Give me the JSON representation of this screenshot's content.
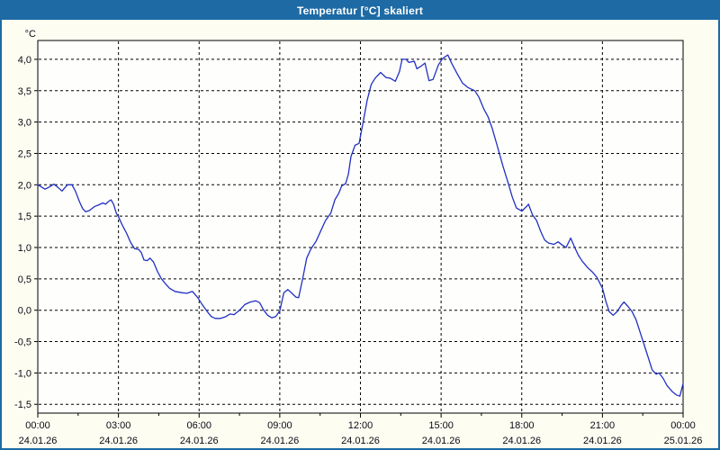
{
  "window": {
    "title": "Temperatur [°C] skaliert"
  },
  "colors": {
    "titlebar_bg": "#1d6aa5",
    "title_text": "#ffffff",
    "window_bg": "#fdfdf2",
    "plot_bg": "#fefefc",
    "grid": "#000000",
    "axis": "#000000",
    "tick_label": "#0a0a14",
    "series_line": "#2130c4"
  },
  "chart_data": {
    "type": "line",
    "title": "Temperatur [°C] skaliert",
    "unit_label": "°C",
    "xlabel": "",
    "ylabel": "°C",
    "xlim": [
      0,
      24
    ],
    "ylim": [
      -1.64,
      4.3
    ],
    "grid": true,
    "legend": "none",
    "yticks": [
      {
        "v": 4.0,
        "label": "4,0"
      },
      {
        "v": 3.5,
        "label": "3,5"
      },
      {
        "v": 3.0,
        "label": "3,0"
      },
      {
        "v": 2.5,
        "label": "2,5"
      },
      {
        "v": 2.0,
        "label": "2,0"
      },
      {
        "v": 1.5,
        "label": "1,5"
      },
      {
        "v": 1.0,
        "label": "1,0"
      },
      {
        "v": 0.5,
        "label": "0,5"
      },
      {
        "v": 0.0,
        "label": "0,0"
      },
      {
        "v": -0.5,
        "label": "-0,5"
      },
      {
        "v": -1.0,
        "label": "-1,0"
      },
      {
        "v": -1.5,
        "label": "-1,5"
      }
    ],
    "xticks": [
      {
        "h": 0,
        "time": "00:00",
        "date": "24.01.26"
      },
      {
        "h": 3,
        "time": "03:00",
        "date": "24.01.26"
      },
      {
        "h": 6,
        "time": "06:00",
        "date": "24.01.26"
      },
      {
        "h": 9,
        "time": "09:00",
        "date": "24.01.26"
      },
      {
        "h": 12,
        "time": "12:00",
        "date": "24.01.26"
      },
      {
        "h": 15,
        "time": "15:00",
        "date": "24.01.26"
      },
      {
        "h": 18,
        "time": "18:00",
        "date": "24.01.26"
      },
      {
        "h": 21,
        "time": "21:00",
        "date": "24.01.26"
      },
      {
        "h": 24,
        "time": "00:00",
        "date": "25.01.26"
      }
    ],
    "minor_xticks": [
      1.5,
      4.5,
      7.5,
      10.5,
      13.5,
      16.5,
      19.5,
      22.5
    ],
    "vertical_gridlines_at": [
      3,
      6,
      9,
      12,
      15,
      18,
      21
    ],
    "series": [
      {
        "name": "Temperatur",
        "color": "#2130c4",
        "points": [
          [
            0.0,
            2.0
          ],
          [
            0.27,
            1.93
          ],
          [
            0.45,
            1.97
          ],
          [
            0.6,
            2.01
          ],
          [
            0.77,
            1.95
          ],
          [
            0.9,
            1.9
          ],
          [
            1.0,
            1.95
          ],
          [
            1.1,
            2.0
          ],
          [
            1.27,
            2.0
          ],
          [
            1.4,
            1.9
          ],
          [
            1.55,
            1.73
          ],
          [
            1.67,
            1.62
          ],
          [
            1.78,
            1.57
          ],
          [
            1.92,
            1.59
          ],
          [
            2.1,
            1.65
          ],
          [
            2.27,
            1.68
          ],
          [
            2.42,
            1.71
          ],
          [
            2.52,
            1.69
          ],
          [
            2.62,
            1.73
          ],
          [
            2.72,
            1.76
          ],
          [
            2.82,
            1.69
          ],
          [
            2.92,
            1.55
          ],
          [
            3.0,
            1.49
          ],
          [
            3.15,
            1.35
          ],
          [
            3.3,
            1.23
          ],
          [
            3.45,
            1.08
          ],
          [
            3.6,
            0.98
          ],
          [
            3.75,
            0.97
          ],
          [
            3.85,
            0.92
          ],
          [
            3.95,
            0.8
          ],
          [
            4.07,
            0.79
          ],
          [
            4.17,
            0.83
          ],
          [
            4.3,
            0.77
          ],
          [
            4.45,
            0.62
          ],
          [
            4.6,
            0.5
          ],
          [
            4.75,
            0.42
          ],
          [
            4.9,
            0.35
          ],
          [
            5.1,
            0.3
          ],
          [
            5.35,
            0.28
          ],
          [
            5.55,
            0.27
          ],
          [
            5.75,
            0.3
          ],
          [
            5.95,
            0.2
          ],
          [
            6.1,
            0.1
          ],
          [
            6.3,
            -0.02
          ],
          [
            6.45,
            -0.1
          ],
          [
            6.6,
            -0.13
          ],
          [
            6.8,
            -0.13
          ],
          [
            7.0,
            -0.1
          ],
          [
            7.15,
            -0.06
          ],
          [
            7.3,
            -0.07
          ],
          [
            7.5,
            0.0
          ],
          [
            7.7,
            0.09
          ],
          [
            7.9,
            0.13
          ],
          [
            8.1,
            0.15
          ],
          [
            8.25,
            0.12
          ],
          [
            8.4,
            0.0
          ],
          [
            8.55,
            -0.08
          ],
          [
            8.7,
            -0.12
          ],
          [
            8.85,
            -0.1
          ],
          [
            9.0,
            -0.01
          ],
          [
            9.15,
            0.28
          ],
          [
            9.3,
            0.33
          ],
          [
            9.45,
            0.27
          ],
          [
            9.6,
            0.21
          ],
          [
            9.7,
            0.2
          ],
          [
            9.85,
            0.5
          ],
          [
            10.0,
            0.83
          ],
          [
            10.15,
            0.97
          ],
          [
            10.35,
            1.1
          ],
          [
            10.55,
            1.29
          ],
          [
            10.7,
            1.43
          ],
          [
            10.9,
            1.55
          ],
          [
            11.05,
            1.76
          ],
          [
            11.2,
            1.87
          ],
          [
            11.3,
            1.98
          ],
          [
            11.45,
            2.02
          ],
          [
            11.55,
            2.17
          ],
          [
            11.65,
            2.45
          ],
          [
            11.8,
            2.63
          ],
          [
            11.95,
            2.66
          ],
          [
            12.1,
            3.0
          ],
          [
            12.25,
            3.35
          ],
          [
            12.4,
            3.6
          ],
          [
            12.55,
            3.7
          ],
          [
            12.75,
            3.79
          ],
          [
            12.95,
            3.71
          ],
          [
            13.1,
            3.7
          ],
          [
            13.3,
            3.65
          ],
          [
            13.45,
            3.8
          ],
          [
            13.55,
            4.0
          ],
          [
            13.7,
            4.0
          ],
          [
            13.8,
            3.95
          ],
          [
            14.0,
            3.97
          ],
          [
            14.1,
            3.85
          ],
          [
            14.25,
            3.89
          ],
          [
            14.4,
            3.94
          ],
          [
            14.55,
            3.66
          ],
          [
            14.7,
            3.68
          ],
          [
            14.9,
            3.91
          ],
          [
            15.05,
            4.01
          ],
          [
            15.25,
            4.07
          ],
          [
            15.4,
            3.93
          ],
          [
            15.6,
            3.77
          ],
          [
            15.8,
            3.62
          ],
          [
            16.0,
            3.55
          ],
          [
            16.25,
            3.5
          ],
          [
            16.4,
            3.4
          ],
          [
            16.6,
            3.2
          ],
          [
            16.75,
            3.08
          ],
          [
            16.9,
            2.9
          ],
          [
            17.1,
            2.6
          ],
          [
            17.3,
            2.3
          ],
          [
            17.5,
            2.02
          ],
          [
            17.65,
            1.8
          ],
          [
            17.8,
            1.63
          ],
          [
            18.0,
            1.58
          ],
          [
            18.15,
            1.64
          ],
          [
            18.25,
            1.69
          ],
          [
            18.4,
            1.52
          ],
          [
            18.55,
            1.43
          ],
          [
            18.7,
            1.26
          ],
          [
            18.85,
            1.12
          ],
          [
            19.0,
            1.07
          ],
          [
            19.2,
            1.05
          ],
          [
            19.35,
            1.09
          ],
          [
            19.5,
            1.04
          ],
          [
            19.65,
            1.0
          ],
          [
            19.82,
            1.15
          ],
          [
            19.95,
            1.02
          ],
          [
            20.1,
            0.88
          ],
          [
            20.25,
            0.78
          ],
          [
            20.45,
            0.68
          ],
          [
            20.65,
            0.6
          ],
          [
            20.8,
            0.52
          ],
          [
            21.0,
            0.35
          ],
          [
            21.12,
            0.15
          ],
          [
            21.25,
            -0.02
          ],
          [
            21.4,
            -0.08
          ],
          [
            21.55,
            -0.02
          ],
          [
            21.7,
            0.08
          ],
          [
            21.8,
            0.13
          ],
          [
            21.95,
            0.06
          ],
          [
            22.1,
            -0.02
          ],
          [
            22.25,
            -0.15
          ],
          [
            22.4,
            -0.35
          ],
          [
            22.55,
            -0.55
          ],
          [
            22.7,
            -0.75
          ],
          [
            22.85,
            -0.95
          ],
          [
            23.0,
            -1.02
          ],
          [
            23.1,
            -1.0
          ],
          [
            23.25,
            -1.08
          ],
          [
            23.4,
            -1.2
          ],
          [
            23.6,
            -1.3
          ],
          [
            23.75,
            -1.35
          ],
          [
            23.88,
            -1.37
          ],
          [
            24.0,
            -1.17
          ]
        ]
      }
    ]
  }
}
